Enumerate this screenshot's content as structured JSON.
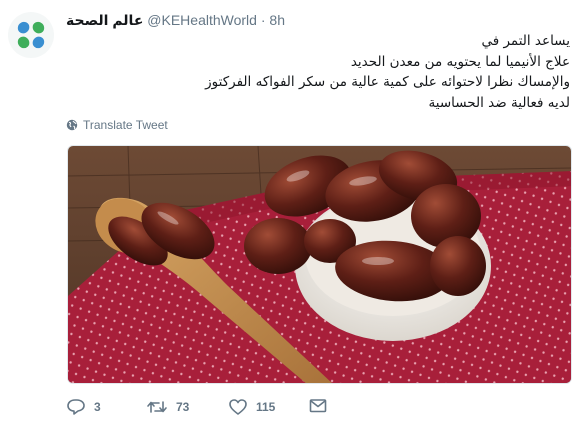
{
  "tweet": {
    "display_name": "عالم الصحة",
    "handle": "@KEHealthWorld",
    "separator": "·",
    "time": "8h",
    "text_lines": [
      "يساعد التمر في",
      "علاج الأنيميا لما يحتويه من معدن الحديد",
      "والإمساك نظرا لاحتوائه على كمية عالية من سكر الفواكه الفركتوز",
      "لديه فعالية ضد الحساسية"
    ],
    "translate_label": "Translate Tweet"
  },
  "actions": {
    "reply_count": "3",
    "retweet_count": "73",
    "like_count": "115"
  },
  "colors": {
    "text_primary": "#14171a",
    "text_secondary": "#657786",
    "avatar_green": "#3fae5b",
    "avatar_blue": "#3a8fd1"
  }
}
